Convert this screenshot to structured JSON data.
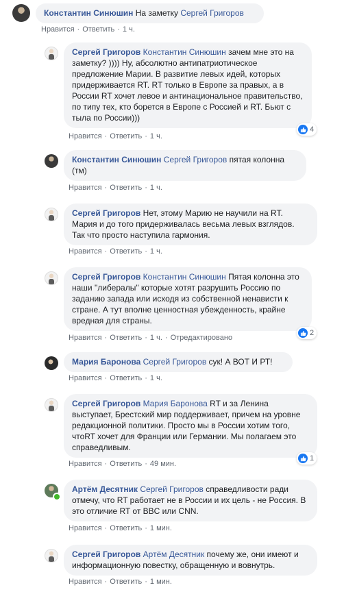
{
  "actions": {
    "like": "Нравится",
    "reply": "Ответить",
    "sep": "·",
    "edited": "Отредактировано"
  },
  "comments": [
    {
      "author": "Константин Синюшин",
      "mention": "",
      "text": "На заметку Сергей Григоров",
      "time": "1 ч."
    },
    {
      "author": "Сергей Григоров",
      "mention": "Константин Синюшин",
      "text": "зачем мне это на заметку? )))) Ну, абсолютно антипатриотическое предложение Марии. В развитие левых идей, которых придерживается RT. RT только в Европе за правых, а в России RT хочет левое и антинациональное правительство, по типу тех, кто борется в Европе с Россией и RT. Бьют с тыла по России)))",
      "time": "1 ч.",
      "reactions": "4"
    },
    {
      "author": "Константин Синюшин",
      "mention": "Сергей Григоров",
      "text": "пятая колонна (тм)",
      "time": "1 ч."
    },
    {
      "author": "Сергей Григоров",
      "mention": "",
      "text": "Нет, этому Марию не научили на RT. Мария и до того придерживалась весьма левых взглядов. Так что просто наступила гармония.",
      "time": "1 ч."
    },
    {
      "author": "Сергей Григоров",
      "mention": "Константин Синюшин",
      "text": "Пятая колонна это наши \"либералы\" которые хотят разрушить Россию по заданию запада или исходя из собственной ненависти к стране. А тут вполне ценностная убежденность, крайне вредная для страны.",
      "time": "1 ч.",
      "reactions": "2"
    },
    {
      "author": "Мария Баронова",
      "mention": "Сергей Григоров",
      "text": "сук! А ВОТ И РТ!",
      "time": "1 ч."
    },
    {
      "author": "Сергей Григоров",
      "mention": "Мария Баронова",
      "text": "RT и за Ленина выступает, Брестский мир поддерживает, причем на уровне редакционной политики. Просто мы в России хотим того, чтоRT хочет для Франции или Германии. Мы полагаем это справедливым.",
      "time": "49 мин.",
      "reactions": "1"
    },
    {
      "author": "Артём Десятник",
      "mention": "Сергей Григоров",
      "text": "справедливости ради отмечу, что RT работает не в России и их цель - не Россия. В это отличие RT от BBC или CNN.",
      "time": "1 мин."
    },
    {
      "author": "Сергей Григоров",
      "mention": "Артём Десятник",
      "text": "почему же, они имеют и информационную повестку, обращенную и вовнутрь.",
      "time": "1 мин."
    }
  ]
}
